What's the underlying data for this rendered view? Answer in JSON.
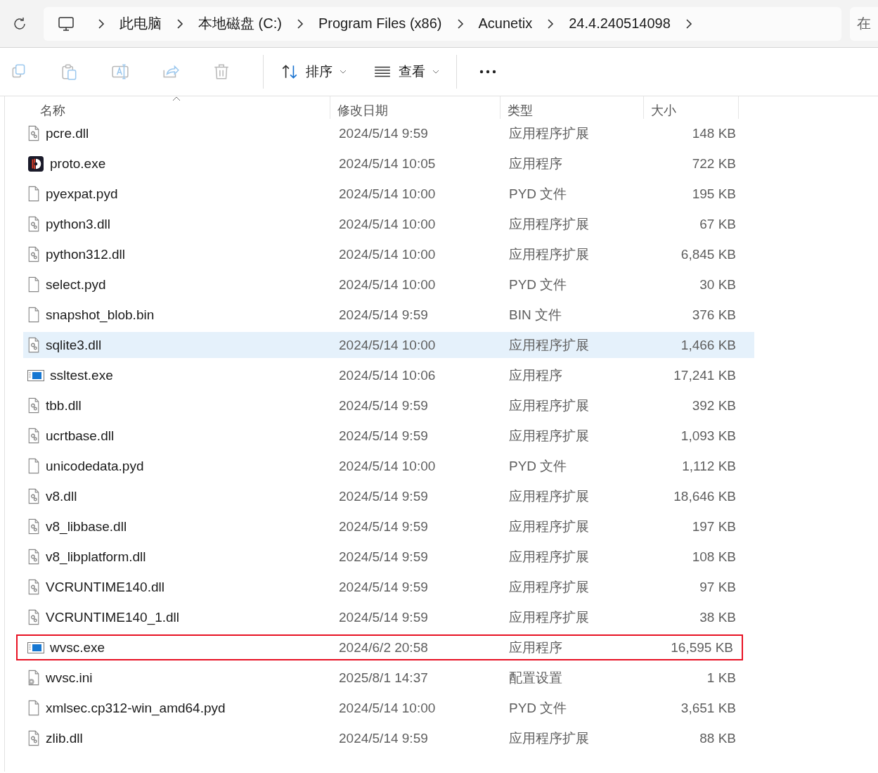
{
  "address_bar": {
    "crumbs": [
      "此电脑",
      "本地磁盘 (C:)",
      "Program Files (x86)",
      "Acunetix",
      "24.4.240514098"
    ]
  },
  "search": {
    "placeholder": "在"
  },
  "toolbar": {
    "actions": [
      {
        "kind": "copy",
        "disabled": true
      },
      {
        "kind": "paste",
        "disabled": true
      },
      {
        "kind": "rename",
        "disabled": true
      },
      {
        "kind": "share",
        "disabled": true
      },
      {
        "kind": "delete",
        "disabled": true
      }
    ],
    "sort": {
      "label": "排序"
    },
    "view": {
      "label": "查看"
    }
  },
  "columns": [
    {
      "label": "名称",
      "sorted": true
    },
    {
      "label": "修改日期",
      "sorted": false
    },
    {
      "label": "类型",
      "sorted": false
    },
    {
      "label": "大小",
      "sorted": false
    }
  ],
  "rows": [
    {
      "kind": "dll",
      "name": "pcre.dll",
      "date": "2024/5/14 9:59",
      "type": "应用程序扩展",
      "size": "148 KB",
      "selected": false,
      "marked": false
    },
    {
      "kind": "app",
      "name": "proto.exe",
      "date": "2024/5/14 10:05",
      "type": "应用程序",
      "size": "722 KB",
      "selected": false,
      "marked": false
    },
    {
      "kind": "file",
      "name": "pyexpat.pyd",
      "date": "2024/5/14 10:00",
      "type": "PYD 文件",
      "size": "195 KB",
      "selected": false,
      "marked": false
    },
    {
      "kind": "dll",
      "name": "python3.dll",
      "date": "2024/5/14 10:00",
      "type": "应用程序扩展",
      "size": "67 KB",
      "selected": false,
      "marked": false
    },
    {
      "kind": "dll",
      "name": "python312.dll",
      "date": "2024/5/14 10:00",
      "type": "应用程序扩展",
      "size": "6,845 KB",
      "selected": false,
      "marked": false
    },
    {
      "kind": "file",
      "name": "select.pyd",
      "date": "2024/5/14 10:00",
      "type": "PYD 文件",
      "size": "30 KB",
      "selected": false,
      "marked": false
    },
    {
      "kind": "file",
      "name": "snapshot_blob.bin",
      "date": "2024/5/14 9:59",
      "type": "BIN 文件",
      "size": "376 KB",
      "selected": false,
      "marked": false
    },
    {
      "kind": "dll",
      "name": "sqlite3.dll",
      "date": "2024/5/14 10:00",
      "type": "应用程序扩展",
      "size": "1,466 KB",
      "selected": true,
      "marked": false
    },
    {
      "kind": "exe",
      "name": "ssltest.exe",
      "date": "2024/5/14 10:06",
      "type": "应用程序",
      "size": "17,241 KB",
      "selected": false,
      "marked": false
    },
    {
      "kind": "dll",
      "name": "tbb.dll",
      "date": "2024/5/14 9:59",
      "type": "应用程序扩展",
      "size": "392 KB",
      "selected": false,
      "marked": false
    },
    {
      "kind": "dll",
      "name": "ucrtbase.dll",
      "date": "2024/5/14 9:59",
      "type": "应用程序扩展",
      "size": "1,093 KB",
      "selected": false,
      "marked": false
    },
    {
      "kind": "file",
      "name": "unicodedata.pyd",
      "date": "2024/5/14 10:00",
      "type": "PYD 文件",
      "size": "1,112 KB",
      "selected": false,
      "marked": false
    },
    {
      "kind": "dll",
      "name": "v8.dll",
      "date": "2024/5/14 9:59",
      "type": "应用程序扩展",
      "size": "18,646 KB",
      "selected": false,
      "marked": false
    },
    {
      "kind": "dll",
      "name": "v8_libbase.dll",
      "date": "2024/5/14 9:59",
      "type": "应用程序扩展",
      "size": "197 KB",
      "selected": false,
      "marked": false
    },
    {
      "kind": "dll",
      "name": "v8_libplatform.dll",
      "date": "2024/5/14 9:59",
      "type": "应用程序扩展",
      "size": "108 KB",
      "selected": false,
      "marked": false
    },
    {
      "kind": "dll",
      "name": "VCRUNTIME140.dll",
      "date": "2024/5/14 9:59",
      "type": "应用程序扩展",
      "size": "97 KB",
      "selected": false,
      "marked": false
    },
    {
      "kind": "dll",
      "name": "VCRUNTIME140_1.dll",
      "date": "2024/5/14 9:59",
      "type": "应用程序扩展",
      "size": "38 KB",
      "selected": false,
      "marked": false
    },
    {
      "kind": "exe",
      "name": "wvsc.exe",
      "date": "2024/6/2 20:58",
      "type": "应用程序",
      "size": "16,595 KB",
      "selected": false,
      "marked": true
    },
    {
      "kind": "ini",
      "name": "wvsc.ini",
      "date": "2025/8/1 14:37",
      "type": "配置设置",
      "size": "1 KB",
      "selected": false,
      "marked": false
    },
    {
      "kind": "file",
      "name": "xmlsec.cp312-win_amd64.pyd",
      "date": "2024/5/14 10:00",
      "type": "PYD 文件",
      "size": "3,651 KB",
      "selected": false,
      "marked": false
    },
    {
      "kind": "dll",
      "name": "zlib.dll",
      "date": "2024/5/14 9:59",
      "type": "应用程序扩展",
      "size": "88 KB",
      "selected": false,
      "marked": false
    }
  ]
}
